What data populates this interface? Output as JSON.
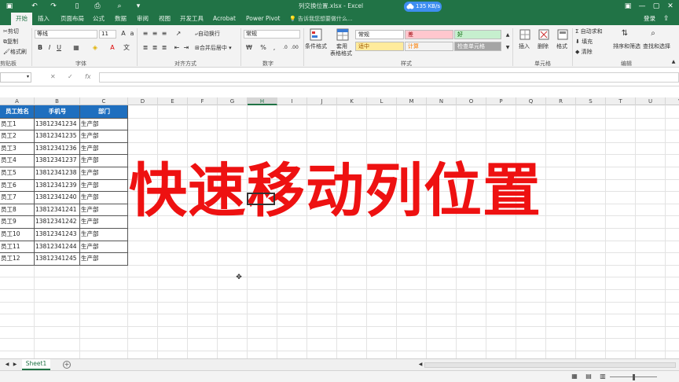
{
  "window": {
    "title": "列交换位置.xlsx - Excel",
    "net_speed": "135 KB/s",
    "quick_access": [
      "save-icon",
      "undo-icon",
      "redo-icon"
    ]
  },
  "tabs": [
    "开始",
    "插入",
    "页面布局",
    "公式",
    "数据",
    "审阅",
    "视图",
    "开发工具",
    "Acrobat",
    "Power Pivot"
  ],
  "active_tab": "开始",
  "tell_me": "告诉我您想要做什么...",
  "login": "登录",
  "ribbon": {
    "clipboard": {
      "cut": "剪切",
      "copy": "复制",
      "painter": "格式刷",
      "label": "剪贴板"
    },
    "font": {
      "name": "等线",
      "size": "11",
      "label": "字体"
    },
    "align": {
      "wrap": "自动换行",
      "merge": "合并后居中",
      "label": "对齐方式"
    },
    "number": {
      "format": "常规",
      "label": "数字"
    },
    "styles": {
      "cond": "条件格式",
      "table1": "套用",
      "table2": "表格格式",
      "cells": [
        "常规",
        "差",
        "好",
        "适中",
        "计算",
        "检查单元格"
      ],
      "label": "样式"
    },
    "cells": {
      "insert": "插入",
      "delete": "删除",
      "format": "格式",
      "label": "单元格"
    },
    "editing": {
      "autosum": "自动求和",
      "fill": "填充",
      "clear": "清除",
      "sort": "排序和筛选",
      "find": "查找和选择",
      "label": "编辑"
    }
  },
  "formula": {
    "fx": "fx",
    "value": ""
  },
  "columns": [
    "A",
    "B",
    "C",
    "D",
    "E",
    "F",
    "G",
    "H",
    "I",
    "J",
    "K",
    "L",
    "M",
    "N",
    "O",
    "P",
    "Q",
    "R",
    "S",
    "T",
    "U",
    "V"
  ],
  "selected_column": "H",
  "table": {
    "headers": [
      "员工姓名",
      "手机号",
      "部门"
    ],
    "rows": [
      [
        "员工1",
        "13812341234",
        "生产部"
      ],
      [
        "员工2",
        "13812341235",
        "生产部"
      ],
      [
        "员工3",
        "13812341236",
        "生产部"
      ],
      [
        "员工4",
        "13812341237",
        "生产部"
      ],
      [
        "员工5",
        "13812341238",
        "生产部"
      ],
      [
        "员工6",
        "13812341239",
        "生产部"
      ],
      [
        "员工7",
        "13812341240",
        "生产部"
      ],
      [
        "员工8",
        "13812341241",
        "生产部"
      ],
      [
        "员工9",
        "13812341242",
        "生产部"
      ],
      [
        "员工10",
        "13812341243",
        "生产部"
      ],
      [
        "员工11",
        "13812341244",
        "生产部"
      ],
      [
        "员工12",
        "13812341245",
        "生产部"
      ]
    ]
  },
  "overlay_text": "快速移动列位置",
  "sheet_tab": "Sheet1",
  "colors": {
    "excel_green": "#217346",
    "header_blue": "#1f6fbf",
    "overlay_red": "#ee1111"
  }
}
